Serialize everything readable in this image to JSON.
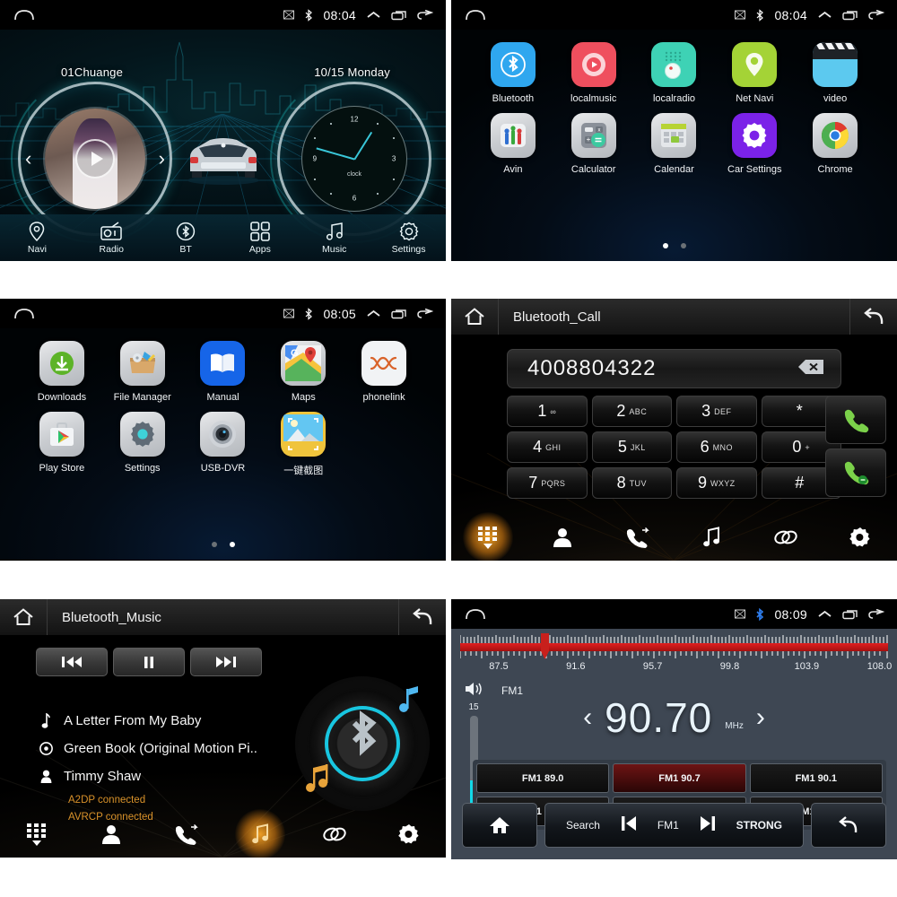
{
  "statusbar": {
    "time_1": "08:04",
    "time_2": "08:04",
    "time_3": "08:05",
    "time_4": "08:09",
    "icons": [
      "sim-icon",
      "bluetooth-icon",
      "collapse-up-icon",
      "recents-icon",
      "back-icon"
    ]
  },
  "home": {
    "media_label": "01Chuange",
    "date_label": "10/15 Monday",
    "clock_word": "clock",
    "clock_numbers": [
      "12",
      "3",
      "6",
      "9"
    ],
    "dock": [
      {
        "label": "Navi",
        "icon": "location-pin-icon"
      },
      {
        "label": "Radio",
        "icon": "radio-icon"
      },
      {
        "label": "BT",
        "icon": "bluetooth-icon"
      },
      {
        "label": "Apps",
        "icon": "grid-apps-icon"
      },
      {
        "label": "Music",
        "icon": "music-note-icon"
      },
      {
        "label": "Settings",
        "icon": "gear-icon"
      }
    ]
  },
  "apps_page1": {
    "row1": [
      {
        "label": "Bluetooth",
        "icon": "bluetooth-app-icon",
        "color": "#2fa7ef"
      },
      {
        "label": "localmusic",
        "icon": "localmusic-app-icon",
        "color": "#ef4f5e"
      },
      {
        "label": "localradio",
        "icon": "localradio-app-icon",
        "color": "#3ed2b5"
      },
      {
        "label": "Net Navi",
        "icon": "netnavi-app-icon",
        "color": "#a4d336"
      },
      {
        "label": "video",
        "icon": "video-app-icon",
        "color": "#5cc9ef"
      }
    ],
    "row2": [
      {
        "label": "Avin",
        "icon": "avin-app-icon",
        "color": "#d3d6da"
      },
      {
        "label": "Calculator",
        "icon": "calculator-app-icon",
        "color": "#c9ccd0"
      },
      {
        "label": "Calendar",
        "icon": "calendar-app-icon",
        "color": "#c9ccd0"
      },
      {
        "label": "Car Settings",
        "icon": "carsettings-app-icon",
        "color": "#7b22e8"
      },
      {
        "label": "Chrome",
        "icon": "chrome-app-icon",
        "color": "#d3d6da"
      }
    ],
    "dots": [
      true,
      false
    ]
  },
  "apps_page2": {
    "row1": [
      {
        "label": "Downloads",
        "icon": "downloads-app-icon",
        "color": "#d3d6da"
      },
      {
        "label": "File Manager",
        "icon": "filemanager-app-icon",
        "color": "#d3d6da"
      },
      {
        "label": "Manual",
        "icon": "manual-app-icon",
        "color": "#1665e8"
      },
      {
        "label": "Maps",
        "icon": "maps-app-icon",
        "color": "#d3d6da"
      },
      {
        "label": "phonelink",
        "icon": "phonelink-app-icon",
        "color": "#eceef0"
      }
    ],
    "row2": [
      {
        "label": "Play Store",
        "icon": "playstore-app-icon",
        "color": "#d3d6da"
      },
      {
        "label": "Settings",
        "icon": "settings-app-icon",
        "color": "#d3d6da"
      },
      {
        "label": "USB-DVR",
        "icon": "usbdvr-app-icon",
        "color": "#d3d6da"
      },
      {
        "label": "一键截图",
        "icon": "screenshot-app-icon",
        "color": "#d3d6da"
      },
      {
        "label": "",
        "icon": "",
        "color": ""
      }
    ],
    "dots": [
      false,
      true
    ]
  },
  "bt_call": {
    "home_icon": "home-icon",
    "title": "Bluetooth_Call",
    "back_icon": "back-arrow-icon",
    "number": "4008804322",
    "backspace_icon": "backspace-icon",
    "keys": [
      {
        "big": "1",
        "sml": "∞"
      },
      {
        "big": "2",
        "sml": "ABC"
      },
      {
        "big": "3",
        "sml": "DEF"
      },
      {
        "big": "*",
        "sml": ""
      },
      {
        "big": "4",
        "sml": "GHI"
      },
      {
        "big": "5",
        "sml": "JKL"
      },
      {
        "big": "6",
        "sml": "MNO"
      },
      {
        "big": "0",
        "sml": "+"
      },
      {
        "big": "7",
        "sml": "PQRS"
      },
      {
        "big": "8",
        "sml": "TUV"
      },
      {
        "big": "9",
        "sml": "WXYZ"
      },
      {
        "big": "#",
        "sml": ""
      }
    ],
    "call_icon": "call-answer-icon",
    "hangup_icon": "call-end-icon",
    "tabs": [
      {
        "icon": "dialpad-icon",
        "active": true
      },
      {
        "icon": "contacts-icon",
        "active": false
      },
      {
        "icon": "calllog-icon",
        "active": false
      },
      {
        "icon": "music-icon",
        "active": false
      },
      {
        "icon": "link-icon",
        "active": false
      },
      {
        "icon": "gear-icon",
        "active": false
      }
    ]
  },
  "bt_music": {
    "home_icon": "home-icon",
    "title": "Bluetooth_Music",
    "back_icon": "back-arrow-icon",
    "transport": [
      {
        "icon": "previous-track-icon"
      },
      {
        "icon": "pause-icon"
      },
      {
        "icon": "next-track-icon"
      }
    ],
    "track": "A Letter From My Baby",
    "album": "Green Book (Original Motion Pi..",
    "artist": "Timmy Shaw",
    "status1": "A2DP connected",
    "status2": "AVRCP connected",
    "track_icon": "note-icon",
    "album_icon": "disc-icon",
    "artist_icon": "person-icon",
    "tabs": [
      {
        "icon": "dialpad-icon",
        "active": false
      },
      {
        "icon": "contacts-icon",
        "active": false
      },
      {
        "icon": "calllog-icon",
        "active": false
      },
      {
        "icon": "music-icon",
        "active": true
      },
      {
        "icon": "link-icon",
        "active": false
      },
      {
        "icon": "gear-icon",
        "active": false
      }
    ]
  },
  "radio": {
    "scale_labels": [
      "87.5",
      "91.6",
      "95.7",
      "99.8",
      "103.9",
      "108.0"
    ],
    "scale_min": 87.5,
    "scale_max": 108.0,
    "volume_icon": "volume-icon",
    "volume_value": "15",
    "volume_percent": 47,
    "band": "FM1",
    "frequency": "90.70",
    "unit": "MHz",
    "prev_chevron": "‹",
    "next_chevron": "›",
    "presets": [
      {
        "label": "FM1 89.0",
        "active": false
      },
      {
        "label": "FM1 90.7",
        "active": true
      },
      {
        "label": "FM1 90.1",
        "active": false
      },
      {
        "label": "FM1 90.6",
        "active": false
      },
      {
        "label": "FM1 91.1",
        "active": false
      },
      {
        "label": "FM1 91.3",
        "active": false
      }
    ],
    "home_icon": "home-icon",
    "search_label": "Search",
    "prev_icon": "skip-prev-icon",
    "band_label": "FM1",
    "next_icon": "skip-next-icon",
    "strong_label": "STRONG",
    "return_icon": "return-arrow-icon"
  }
}
